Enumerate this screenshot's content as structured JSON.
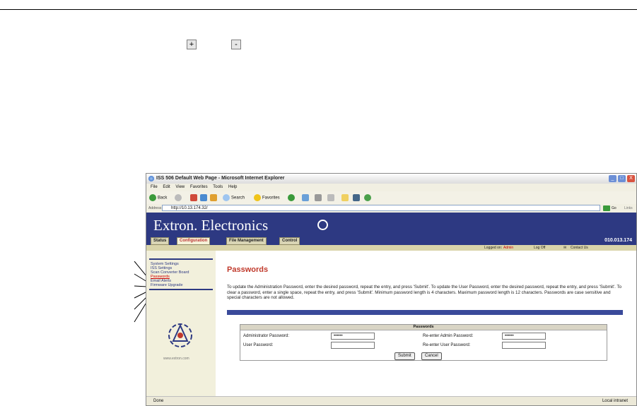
{
  "zoom": {
    "plus": "+",
    "minus": "-"
  },
  "window": {
    "title": "ISS 506 Default Web Page - Microsoft Internet Explorer",
    "controls": [
      "_",
      "□",
      "X"
    ]
  },
  "menu": [
    "File",
    "Edit",
    "View",
    "Favorites",
    "Tools",
    "Help"
  ],
  "toolbar": {
    "back": "Back",
    "search": "Search",
    "favorites": "Favorites"
  },
  "address": {
    "label": "Address",
    "url": "http://10.13.174.32/",
    "go": "Go",
    "links": "Links"
  },
  "site": {
    "brand": "Extron. Electronics",
    "tabs": [
      "Status",
      "Configuration",
      "File Management",
      "Control"
    ],
    "active_tab": "Configuration",
    "ip": "010.013.174",
    "logged_in_prefix": "Logged on:",
    "logged_in_user": "Admin",
    "log_off": "Log Off",
    "contact": "Contact Us"
  },
  "sidebar": {
    "items": [
      "System Settings",
      "ISS Settings",
      "Scan Converter Board",
      "Passwords",
      "Email Alerts",
      "Firmware Upgrade"
    ],
    "active": "Passwords",
    "url": "www.extron.com"
  },
  "content": {
    "title": "Passwords",
    "description": "To update the Administration Password, enter the desired password, repeat the entry, and press 'Submit'. To update the User Password, enter the desired password, repeat the entry, and press 'Submit'. To clear a password, enter a single space, repeat the entry, and press 'Submit'. Minimum password length is 4 characters. Maximum password length is 12 characters. Passwords are case sensitive and special characters are not allowed.",
    "form_header": "Passwords",
    "admin_label": "Administrator Password:",
    "admin_value": "••••••",
    "readmin_label": "Re-enter Admin Password:",
    "readmin_value": "••••••",
    "user_label": "User Password:",
    "user_value": "",
    "reuser_label": "Re-enter User Password:",
    "reuser_value": "",
    "submit": "Submit",
    "cancel": "Cancel"
  },
  "status": {
    "left": "Done",
    "right": "Local intranet"
  }
}
